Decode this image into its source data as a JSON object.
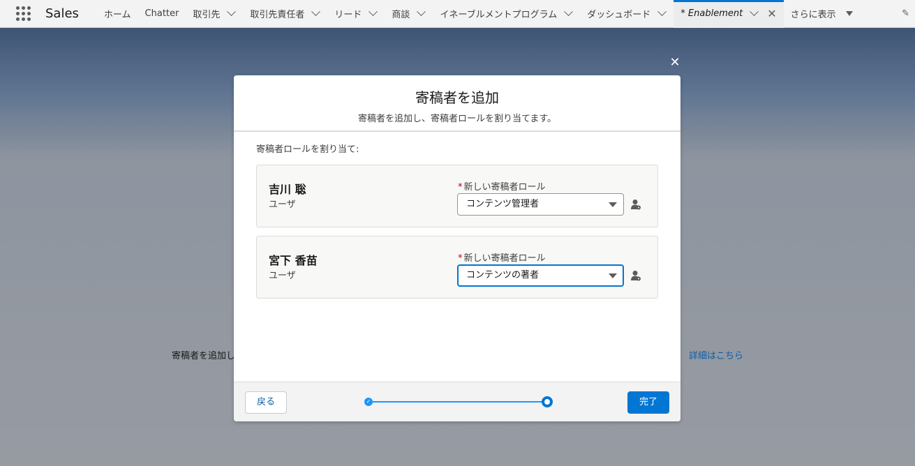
{
  "nav": {
    "app_name": "Sales",
    "items": [
      {
        "label": "ホーム"
      },
      {
        "label": "Chatter"
      },
      {
        "label": "取引先"
      },
      {
        "label": "取引先責任者"
      },
      {
        "label": "リード"
      },
      {
        "label": "商談"
      },
      {
        "label": "イネーブルメントプログラム"
      },
      {
        "label": "ダッシュボード"
      }
    ],
    "active_tab": "* Enablement",
    "more_label": "さらに表示"
  },
  "background": {
    "text": "寄稿者を追加し",
    "link": "詳細はこちら"
  },
  "modal": {
    "title": "寄稿者を追加",
    "subtitle": "寄稿者を追加し、寄稿者ロールを割り当てます。",
    "section_label": "寄稿者ロールを割り当て:",
    "contributors": [
      {
        "name": "吉川 聡",
        "type": "ユーザ",
        "role_label": "新しい寄稿者ロール",
        "role_value": "コンテンツ管理者"
      },
      {
        "name": "宮下 香苗",
        "type": "ユーザ",
        "role_label": "新しい寄稿者ロール",
        "role_value": "コンテンツの著者"
      }
    ],
    "back_label": "戻る",
    "done_label": "完了",
    "progress": {
      "current_step": 2,
      "total_steps": 2
    }
  },
  "colors": {
    "brand": "#0176d3",
    "required": "#ba0517",
    "link": "#0b5cab"
  }
}
